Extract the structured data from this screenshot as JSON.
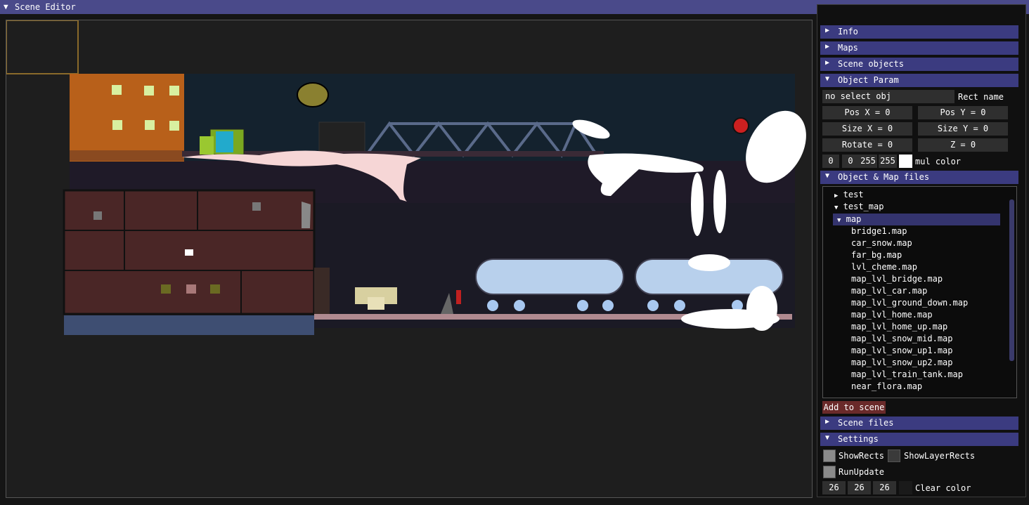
{
  "window": {
    "title": "Scene Editor",
    "title_arrow": "▼"
  },
  "panel": {
    "sections": {
      "info": "Info",
      "maps": "Maps",
      "scene_objects": "Scene objects",
      "object_param": "Object Param",
      "object_map_files": "Object & Map files",
      "scene_files": "Scene files",
      "settings": "Settings"
    },
    "object_param": {
      "selected": "no select obj",
      "rect_name": "Rect name",
      "pos_x": "Pos X = 0",
      "pos_y": "Pos Y = 0",
      "size_x": "Size X = 0",
      "size_y": "Size Y = 0",
      "rotate": "Rotate = 0",
      "z": "Z = 0",
      "color_r": "0",
      "color_g": "0",
      "color_b": "255",
      "color_a": "255",
      "mul_color": "mul color"
    },
    "tree": {
      "root1": "test",
      "root2": "test_map",
      "folder": "map",
      "files": [
        "bridge1.map",
        "car_snow.map",
        "far_bg.map",
        "lvl_cheme.map",
        "map_lvl_bridge.map",
        "map_lvl_car.map",
        "map_lvl_ground_down.map",
        "map_lvl_home.map",
        "map_lvl_home_up.map",
        "map_lvl_snow_mid.map",
        "map_lvl_snow_up1.map",
        "map_lvl_snow_up2.map",
        "map_lvl_train_tank.map",
        "near_flora.map"
      ]
    },
    "add_to_scene": "Add to scene",
    "settings": {
      "show_rects": "ShowRects",
      "show_layer_rects": "ShowLayerRects",
      "run_update": "RunUpdate",
      "clear_r": "26",
      "clear_g": "26",
      "clear_b": "26",
      "clear_color": "Clear color"
    }
  },
  "colors": {
    "accent": "#3b3b80",
    "title_bar": "#4a4a8a",
    "background": "#1e1e1e"
  }
}
